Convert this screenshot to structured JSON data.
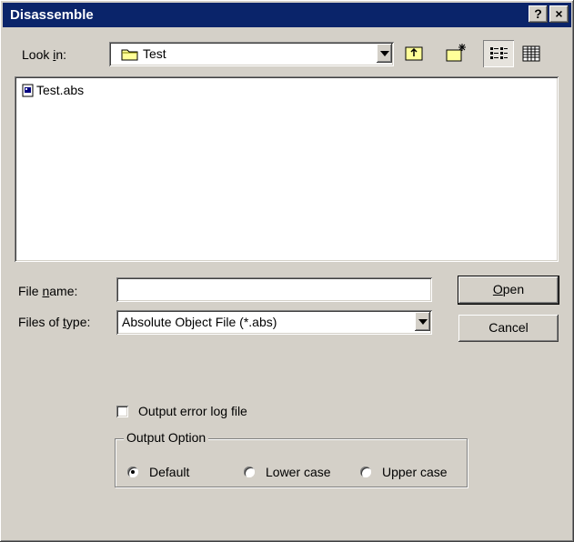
{
  "window": {
    "title": "Disassemble",
    "help_label": "?",
    "close_label": "×"
  },
  "lookin": {
    "label_pre": "Look ",
    "label_u": "i",
    "label_post": "n:",
    "value": "Test"
  },
  "toolbar": {
    "up_icon": "up-folder-icon",
    "newfolder_icon": "new-folder-icon",
    "list_icon": "list-view-icon",
    "details_icon": "details-view-icon"
  },
  "files": [
    {
      "name": "Test.abs",
      "icon": "file-icon"
    }
  ],
  "filename": {
    "label_pre": "File ",
    "label_u": "n",
    "label_post": "ame:",
    "value": ""
  },
  "filetype": {
    "label_pre": "Files of ",
    "label_u": "t",
    "label_post": "ype:",
    "value": "Absolute Object File (*.abs)"
  },
  "buttons": {
    "open_u": "O",
    "open_rest": "pen",
    "cancel": "Cancel"
  },
  "options": {
    "error_log": {
      "label": "Output error log file",
      "checked": false
    },
    "group_label": "Output Option",
    "radios": [
      {
        "label": "Default",
        "selected": true
      },
      {
        "label": "Lower case",
        "selected": false
      },
      {
        "label": "Upper case",
        "selected": false
      }
    ]
  }
}
